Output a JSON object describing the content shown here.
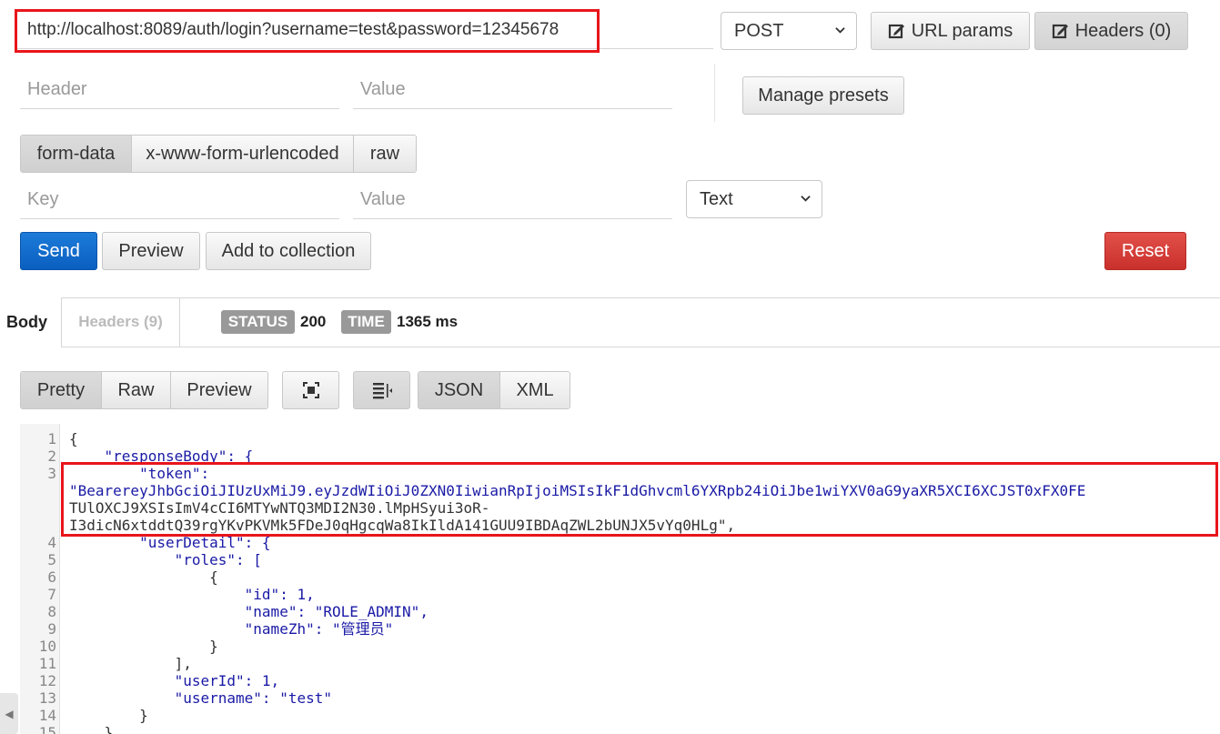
{
  "request": {
    "url": "http://localhost:8089/auth/login?username=test&password=12345678",
    "method": "POST",
    "url_params_label": "URL params",
    "headers_label": "Headers (0)",
    "header_placeholder": "Header",
    "value_placeholder": "Value",
    "manage_presets_label": "Manage presets",
    "body_tabs": [
      "form-data",
      "x-www-form-urlencoded",
      "raw"
    ],
    "key_placeholder": "Key",
    "body_value_placeholder": "Value",
    "type_select": "Text",
    "send_label": "Send",
    "preview_label": "Preview",
    "add_collection_label": "Add to collection",
    "reset_label": "Reset"
  },
  "response": {
    "tab_body": "Body",
    "tab_headers": "Headers (9)",
    "status_label": "STATUS",
    "status_value": "200",
    "time_label": "TIME",
    "time_value": "1365 ms",
    "view_tabs": [
      "Pretty",
      "Raw",
      "Preview"
    ],
    "format_tabs": [
      "JSON",
      "XML"
    ],
    "lines": [
      {
        "n": "1",
        "text": "{"
      },
      {
        "n": "2",
        "text": "    \"responseBody\": {"
      },
      {
        "n": "3",
        "text": "        \"token\":"
      },
      {
        "n": "",
        "text": "\"BearereyJhbGciOiJIUzUxMiJ9.eyJzdWIiOiJ0ZXN0IiwianRpIjoiMSIsIkF1dGhvcml6YXRpb24iOiJbe1wiYXV0aG9yaXR5XCI6XCJST0xFX0FE"
      },
      {
        "n": "",
        "text": "TUlOXCJ9XSIsImV4cCI6MTYwNTQ3MDI2N30.lMpHSyui3oR-"
      },
      {
        "n": "",
        "text": "I3dicN6xtddtQ39rgYKvPKVMk5FDeJ0qHgcqWa8IkIldA141GUU9IBDAqZWL2bUNJX5vYq0HLg\","
      },
      {
        "n": "4",
        "text": "        \"userDetail\": {"
      },
      {
        "n": "5",
        "text": "            \"roles\": ["
      },
      {
        "n": "6",
        "text": "                {"
      },
      {
        "n": "7",
        "text": "                    \"id\": 1,"
      },
      {
        "n": "8",
        "text": "                    \"name\": \"ROLE_ADMIN\","
      },
      {
        "n": "9",
        "text": "                    \"nameZh\": \"管理员\""
      },
      {
        "n": "10",
        "text": "                }"
      },
      {
        "n": "11",
        "text": "            ],"
      },
      {
        "n": "12",
        "text": "            \"userId\": 1,"
      },
      {
        "n": "13",
        "text": "            \"username\": \"test\""
      },
      {
        "n": "14",
        "text": "        }"
      },
      {
        "n": "15",
        "text": "    }"
      }
    ]
  },
  "colors": {
    "highlight": "#e8151b",
    "send": "#0a5fc0",
    "reset": "#c9302c"
  },
  "icons": [
    "edit-icon",
    "chevron-down-icon",
    "fullscreen-icon",
    "wrap-lines-icon"
  ]
}
